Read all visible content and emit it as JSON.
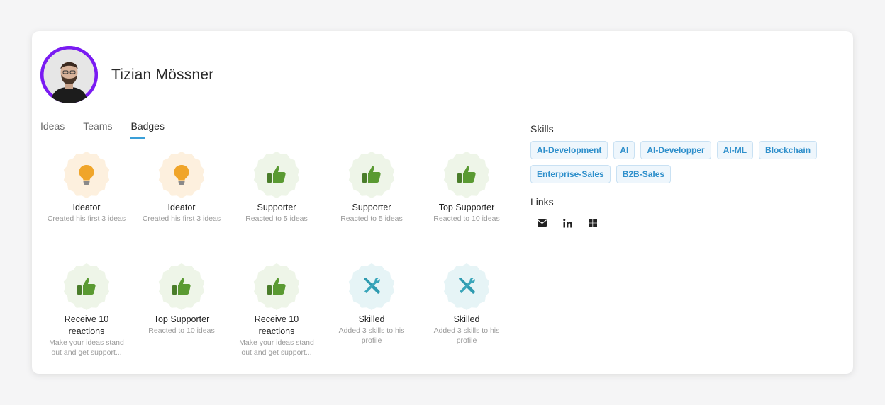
{
  "profile": {
    "name": "Tizian Mössner"
  },
  "tabs": [
    {
      "label": "Ideas",
      "active": false
    },
    {
      "label": "Teams",
      "active": false
    },
    {
      "label": "Badges",
      "active": true
    }
  ],
  "badges": [
    {
      "icon": "lightbulb-icon",
      "title": "Ideator",
      "desc": "Created his first 3 ideas"
    },
    {
      "icon": "lightbulb-icon",
      "title": "Ideator",
      "desc": "Created his first 3 ideas"
    },
    {
      "icon": "thumbs-up-icon",
      "title": "Supporter",
      "desc": "Reacted to 5 ideas"
    },
    {
      "icon": "thumbs-up-icon",
      "title": "Supporter",
      "desc": "Reacted to 5 ideas"
    },
    {
      "icon": "thumbs-up-icon",
      "title": "Top Supporter",
      "desc": "Reacted to 10 ideas"
    },
    {
      "icon": "thumbs-up-icon",
      "title": "Receive 10 reactions",
      "desc": "Make your ideas stand out and get support..."
    },
    {
      "icon": "thumbs-up-icon",
      "title": "Top Supporter",
      "desc": "Reacted to 10 ideas"
    },
    {
      "icon": "thumbs-up-icon",
      "title": "Receive 10 reactions",
      "desc": "Make your ideas stand out and get support..."
    },
    {
      "icon": "tools-icon",
      "title": "Skilled",
      "desc": "Added 3 skills to his profile"
    },
    {
      "icon": "tools-icon",
      "title": "Skilled",
      "desc": "Added 3 skills to his profile"
    }
  ],
  "skills_title": "Skills",
  "skills": [
    "AI-Development",
    "AI",
    "AI-Developper",
    "AI-ML",
    "Blockchain",
    "Enterprise-Sales",
    "B2B-Sales"
  ],
  "links_title": "Links",
  "links": [
    {
      "icon": "mail-icon"
    },
    {
      "icon": "linkedin-icon"
    },
    {
      "icon": "windows-icon"
    }
  ],
  "colors": {
    "avatar_bg": "#7a1bf2",
    "tab_underline": "#3a9fd8",
    "skill_text": "#2e8fcb",
    "bulb": "#f0a52a",
    "thumb": "#5a9a32",
    "tools": "#2f9bb0"
  }
}
